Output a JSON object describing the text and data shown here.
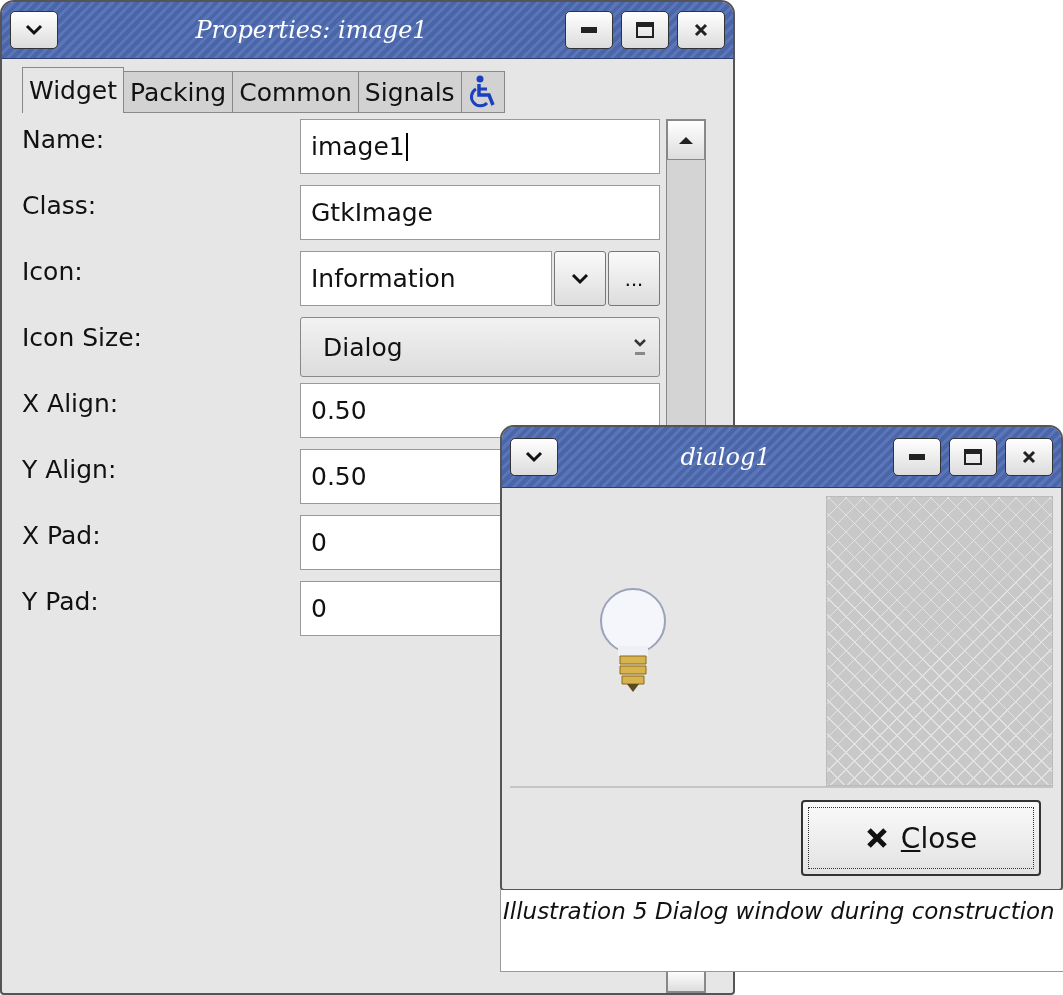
{
  "properties_window": {
    "title": "Properties: image1",
    "tabs": [
      {
        "kind": "text",
        "label": "Widget",
        "selected": true
      },
      {
        "kind": "text",
        "label": "Packing",
        "selected": false
      },
      {
        "kind": "text",
        "label": "Common",
        "selected": false
      },
      {
        "kind": "text",
        "label": "Signals",
        "selected": false
      },
      {
        "kind": "icon",
        "selected": false
      }
    ],
    "fields": [
      {
        "label": "Name:",
        "kind": "text",
        "value": "image1"
      },
      {
        "label": "Class:",
        "kind": "text",
        "value": "GtkImage"
      },
      {
        "label": "Icon:",
        "kind": "combo",
        "value": "Information",
        "more": "..."
      },
      {
        "label": "Icon Size:",
        "kind": "dropdown",
        "value": "Dialog"
      },
      {
        "label": "X Align:",
        "kind": "text",
        "value": "0.50"
      },
      {
        "label": "Y Align:",
        "kind": "text",
        "value": "0.50"
      },
      {
        "label": "X Pad:",
        "kind": "text",
        "value": "0"
      },
      {
        "label": "Y Pad:",
        "kind": "text",
        "value": "0"
      }
    ]
  },
  "dialog_window": {
    "title": "dialog1",
    "button": {
      "label": "Close"
    }
  },
  "caption": "Illustration 5 Dialog window during construction"
}
